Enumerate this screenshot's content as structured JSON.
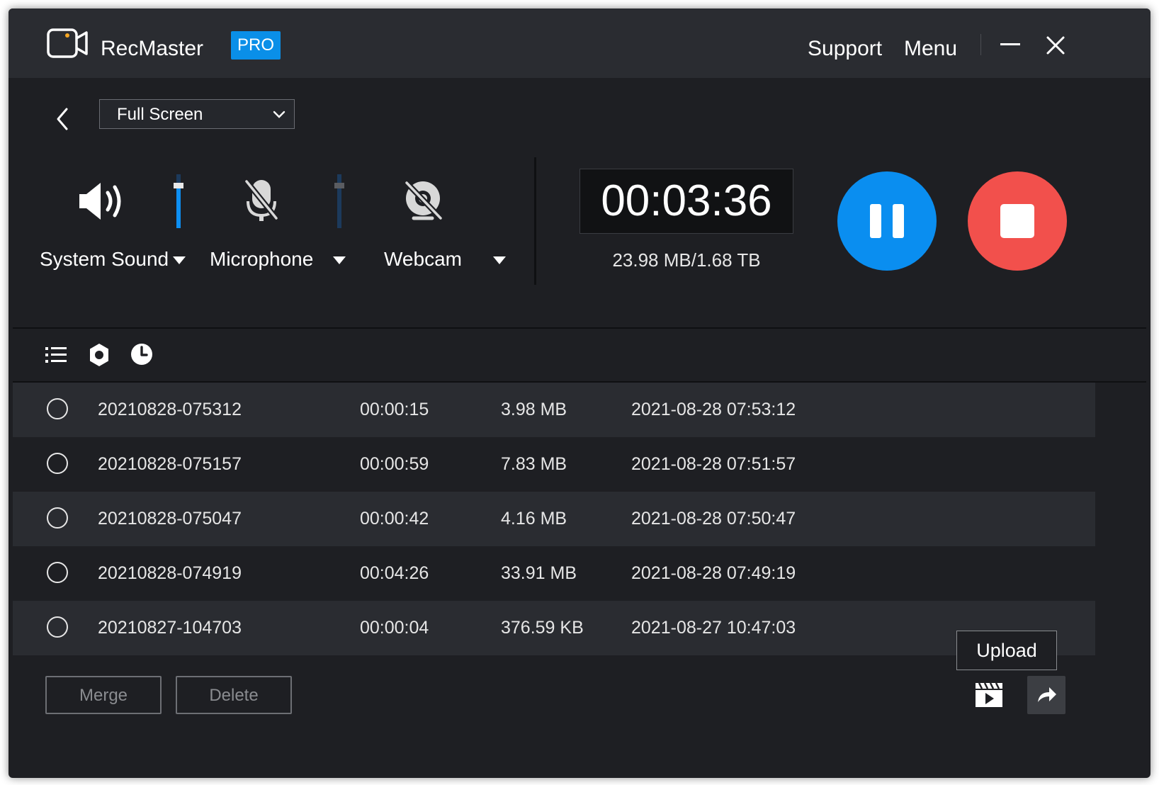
{
  "titlebar": {
    "app_name": "RecMaster",
    "badge": "PRO",
    "support": "Support",
    "menu": "Menu",
    "icons": [
      "camera-logo-icon",
      "minimize-icon",
      "close-icon"
    ]
  },
  "capture": {
    "mode": "Full Screen",
    "sources": [
      {
        "label": "System Sound",
        "icon": "speaker-icon",
        "volume_percent": 90
      },
      {
        "label": "Microphone",
        "icon": "microphone-muted-icon",
        "volume_percent": 90
      },
      {
        "label": "Webcam",
        "icon": "webcam-off-icon"
      }
    ]
  },
  "recording": {
    "elapsed": "00:03:36",
    "size": "23.98 MB/1.68 TB"
  },
  "toolbar_icons": [
    "list-icon",
    "settings-icon",
    "schedule-clock-icon"
  ],
  "recordings": [
    {
      "name": "20210828-075312",
      "duration": "00:00:15",
      "size": "3.98 MB",
      "date": "2021-08-28 07:53:12"
    },
    {
      "name": "20210828-075157",
      "duration": "00:00:59",
      "size": "7.83 MB",
      "date": "2021-08-28 07:51:57"
    },
    {
      "name": "20210828-075047",
      "duration": "00:00:42",
      "size": "4.16 MB",
      "date": "2021-08-28 07:50:47"
    },
    {
      "name": "20210828-074919",
      "duration": "00:04:26",
      "size": "33.91 MB",
      "date": "2021-08-28 07:49:19"
    },
    {
      "name": "20210827-104703",
      "duration": "00:00:04",
      "size": "376.59 KB",
      "date": "2021-08-27 10:47:03"
    }
  ],
  "actions": {
    "merge": "Merge",
    "delete": "Delete",
    "upload_tooltip": "Upload"
  },
  "colors": {
    "window_bg": "#1e1f23",
    "titlebar_bg": "#2a2c31",
    "accent_blue": "#0a8ef0",
    "stop_red": "#f2504c"
  }
}
